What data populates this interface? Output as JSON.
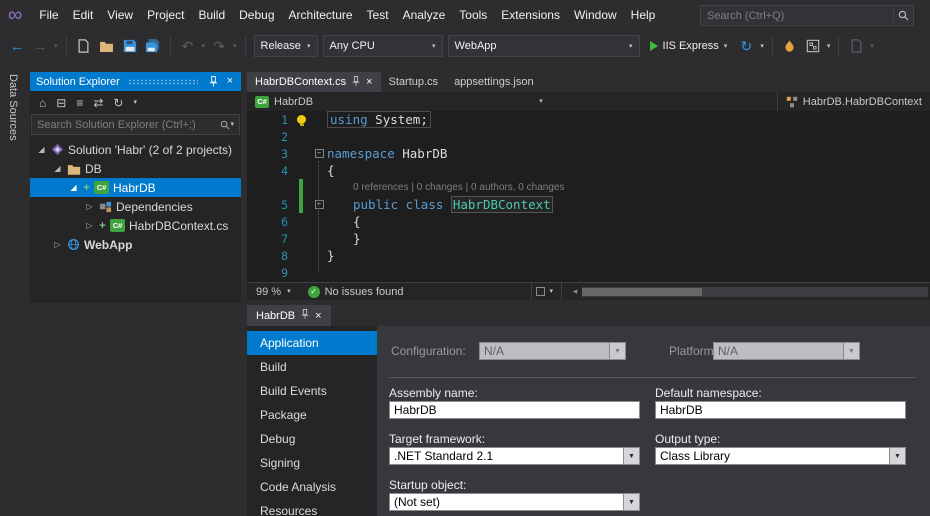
{
  "titlebar": {
    "menus": [
      "File",
      "Edit",
      "View",
      "Project",
      "Build",
      "Debug",
      "Architecture",
      "Test",
      "Analyze",
      "Tools",
      "Extensions",
      "Window",
      "Help"
    ],
    "search_placeholder": "Search (Ctrl+Q)"
  },
  "toolbar": {
    "config": "Release",
    "platform": "Any CPU",
    "startup_project": "WebApp",
    "run": "IIS Express"
  },
  "side_strip": {
    "label": "Data Sources"
  },
  "solution_explorer": {
    "title": "Solution Explorer",
    "search_placeholder": "Search Solution Explorer (Ctrl+;)",
    "items": {
      "solution": "Solution 'Habr' (2 of 2 projects)",
      "db": "DB",
      "habrdb": "HabrDB",
      "dependencies": "Dependencies",
      "context_file": "HabrDBContext.cs",
      "webapp": "WebApp"
    }
  },
  "editor": {
    "tabs": [
      "HabrDBContext.cs",
      "Startup.cs",
      "appsettings.json"
    ],
    "breadcrumb": "HabrDB",
    "type_nav": "HabrDB.HabrDBContext",
    "zoom": "99 %",
    "status": "No issues found",
    "code": {
      "nums": [
        "1",
        "2",
        "3",
        "4",
        "5",
        "6",
        "7",
        "8",
        "9"
      ],
      "l1_kw": "using",
      "l1_rest": " System;",
      "l3_kw": "namespace",
      "l3_name": " HabrDB",
      "l4": "{",
      "lens": "0 references | 0 changes | 0 authors, 0 changes",
      "l5_kw": "public class ",
      "l5_name": "HabrDBContext",
      "l6": "{",
      "l7": "}",
      "l8": "}"
    }
  },
  "properties": {
    "tab": "HabrDB",
    "nav": [
      "Application",
      "Build",
      "Build Events",
      "Package",
      "Debug",
      "Signing",
      "Code Analysis",
      "Resources"
    ],
    "configuration_label": "Configuration:",
    "configuration_value": "N/A",
    "platform_label": "Platform:",
    "platform_value": "N/A",
    "assembly_label": "Assembly name:",
    "assembly_value": "HabrDB",
    "default_namespace_label": "Default namespace:",
    "default_namespace_value": "HabrDB",
    "target_framework_label": "Target framework:",
    "target_framework_value": ".NET Standard 2.1",
    "output_type_label": "Output type:",
    "output_type_value": "Class Library",
    "startup_object_label": "Startup object:",
    "startup_object_value": "(Not set)"
  },
  "icons": {
    "logo": "∞",
    "caret": "▾",
    "back": "←",
    "forward": "→",
    "undo": "↶",
    "redo": "↷",
    "refresh": "↻",
    "home": "⌂",
    "collapse_all": "⊟",
    "show_all": "≡",
    "sync": "⇄",
    "close": "×",
    "check": "✓",
    "minus": "−",
    "twisty_open": "◢",
    "twisty_closed": "▷",
    "plus": "+",
    "scroll_left": "◂"
  }
}
